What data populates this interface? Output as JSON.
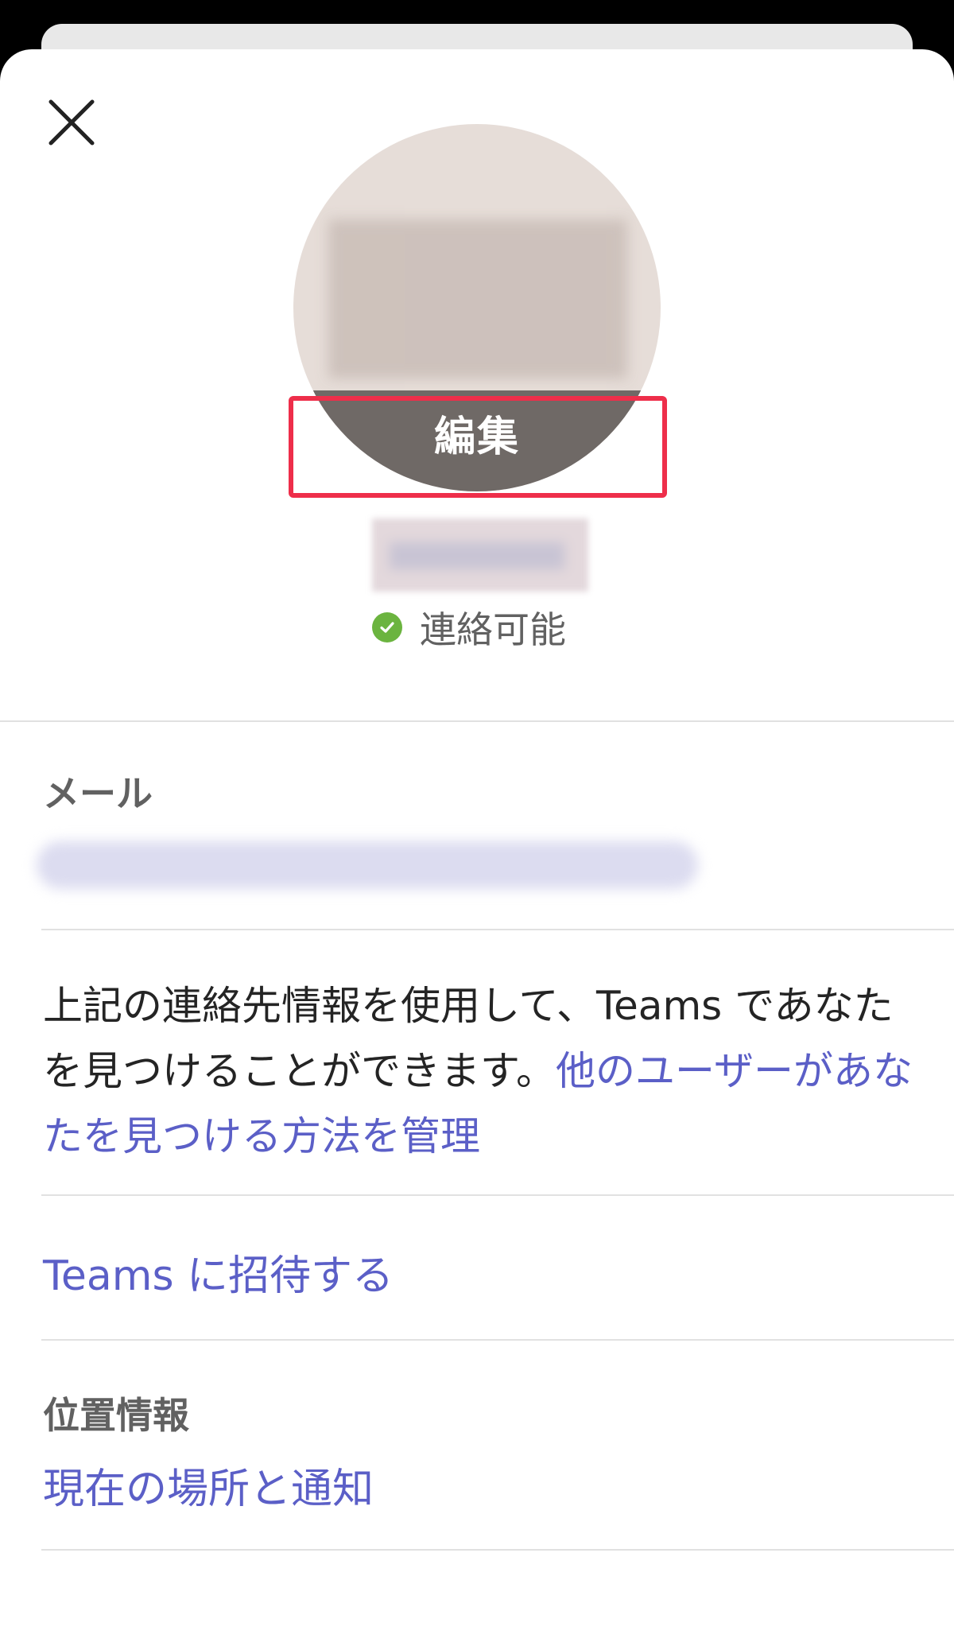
{
  "profile": {
    "edit_label": "編集",
    "status_text": "連絡可能",
    "status_color": "#6bb43f",
    "highlight_color": "#ee2e4a"
  },
  "email_section": {
    "label": "メール"
  },
  "discoverability": {
    "text": "上記の連絡先情報を使用して、Teams であなたを見つけることができます。",
    "link": "他のユーザーがあなたを見つける方法を管理"
  },
  "invite_link": "Teams に招待する",
  "location_section": {
    "label": "位置情報",
    "link": "現在の場所と通知"
  },
  "colors": {
    "accent": "#5b5fc7",
    "text_primary": "#242424",
    "text_secondary": "#616161"
  }
}
